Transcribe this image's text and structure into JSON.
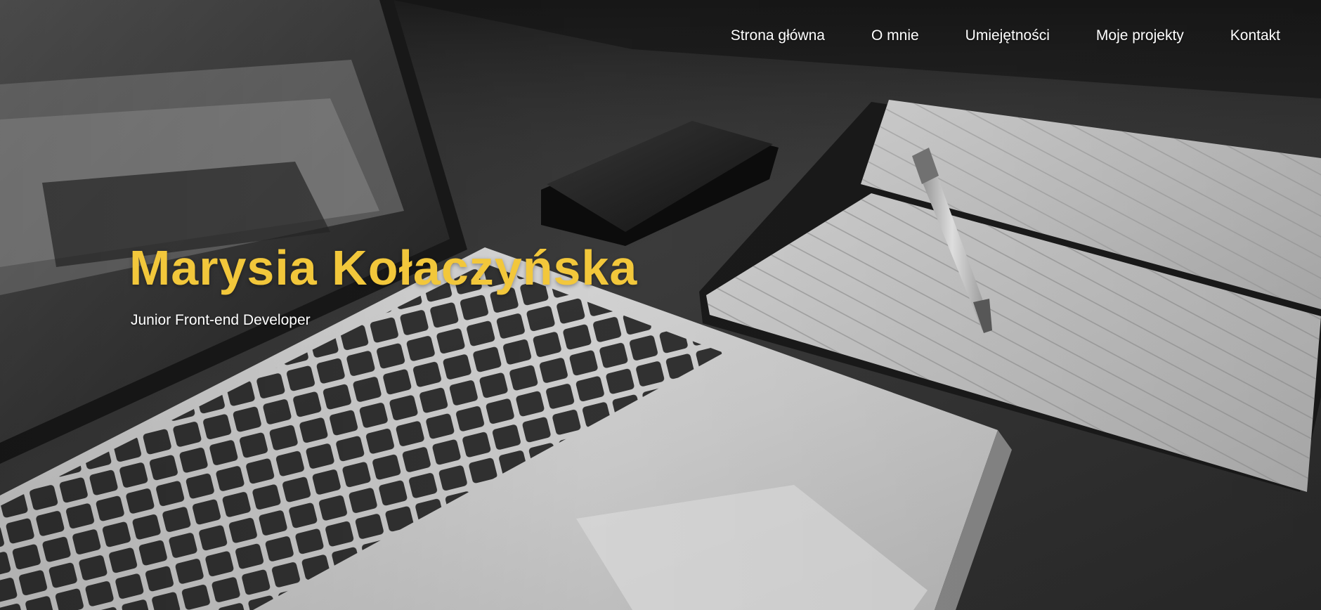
{
  "nav": {
    "items": [
      {
        "label": "Strona główna"
      },
      {
        "label": "O mnie"
      },
      {
        "label": "Umiejętności"
      },
      {
        "label": "Moje projekty"
      },
      {
        "label": "Kontakt"
      }
    ]
  },
  "hero": {
    "name": "Marysia Kołaczyńska",
    "role": "Junior Front-end Developer",
    "background": "grayscale desk photo with laptop, smartphone, notebook and pen"
  },
  "colors": {
    "accent": "#f2c73b",
    "nav_text": "#ffffff"
  }
}
